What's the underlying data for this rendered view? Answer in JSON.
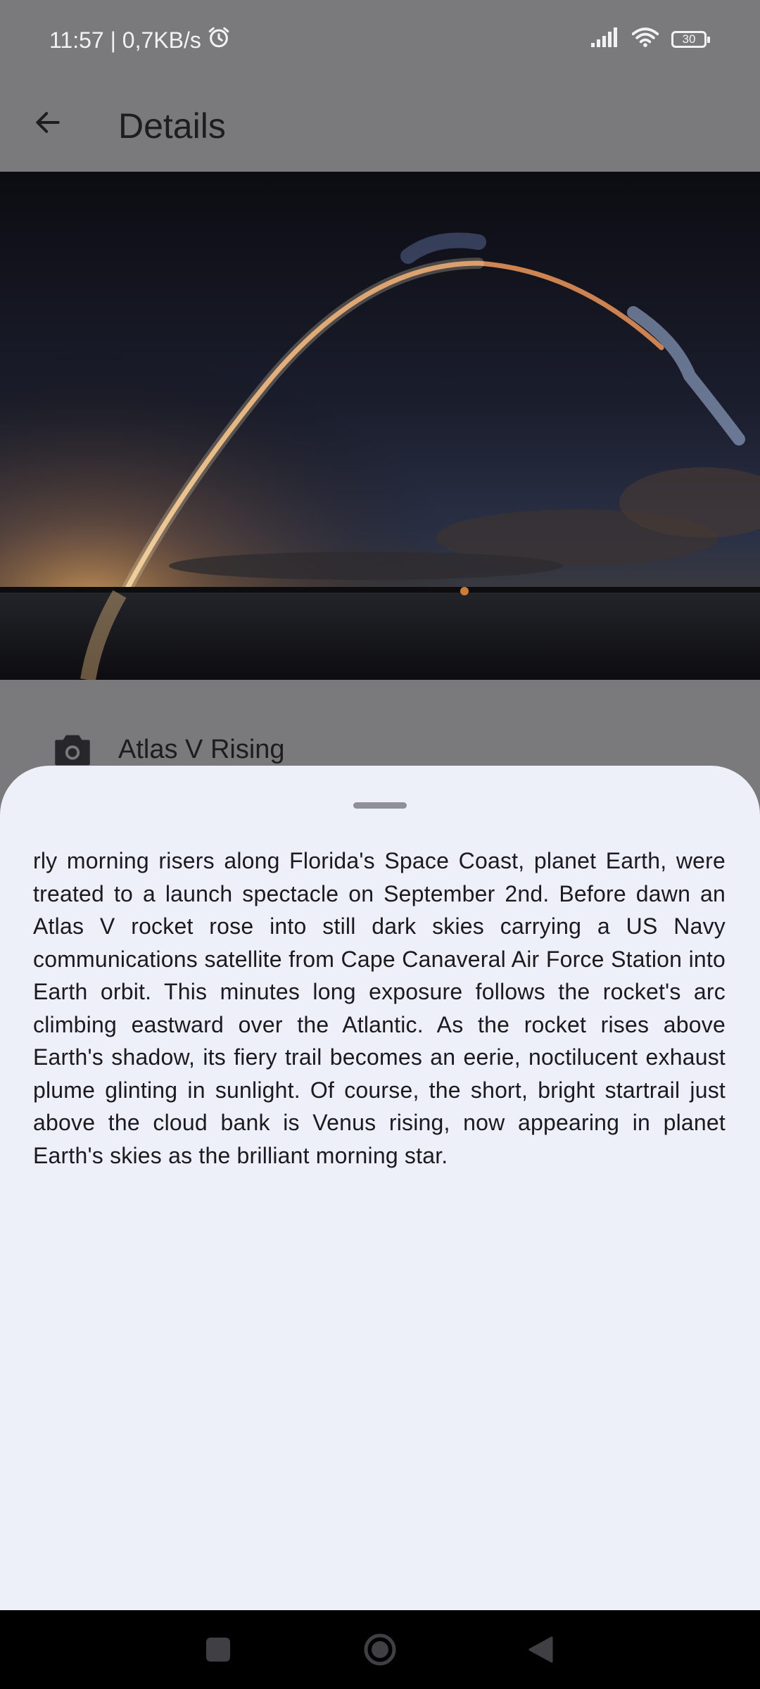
{
  "status_bar": {
    "time_speed": "11:57 | 0,7KB/s",
    "battery_level": "30",
    "icons": [
      "alarm-icon",
      "signal-icon",
      "wifi-icon",
      "battery-icon"
    ]
  },
  "app_bar": {
    "title": "Details",
    "back_icon": "arrow-back-icon"
  },
  "photo": {
    "title": "Atlas V Rising",
    "icon": "camera-icon"
  },
  "sheet": {
    "description": "rly morning risers along Florida's Space Coast, planet Earth, were treated to a launch spectacle on September 2nd. Before dawn an Atlas V rocket rose into still dark skies carrying a US Navy communications satellite from Cape Canaveral Air Force Station into Earth orbit. This minutes long exposure follows the rocket's arc climbing eastward over the Atlantic. As the rocket rises above Earth's shadow, its fiery trail becomes an eerie, noctilucent exhaust plume glinting in sunlight. Of course, the short, bright startrail just above the cloud bank is Venus rising, now appearing in planet Earth's skies as the brilliant morning star."
  },
  "nav_bar": {
    "buttons": [
      "recents-button",
      "home-button",
      "back-button"
    ]
  },
  "colors": {
    "scrim": "#7a7a7c",
    "sheet_background": "#eef0f9",
    "text": "#1b1b1f",
    "nav_background": "#000000"
  }
}
